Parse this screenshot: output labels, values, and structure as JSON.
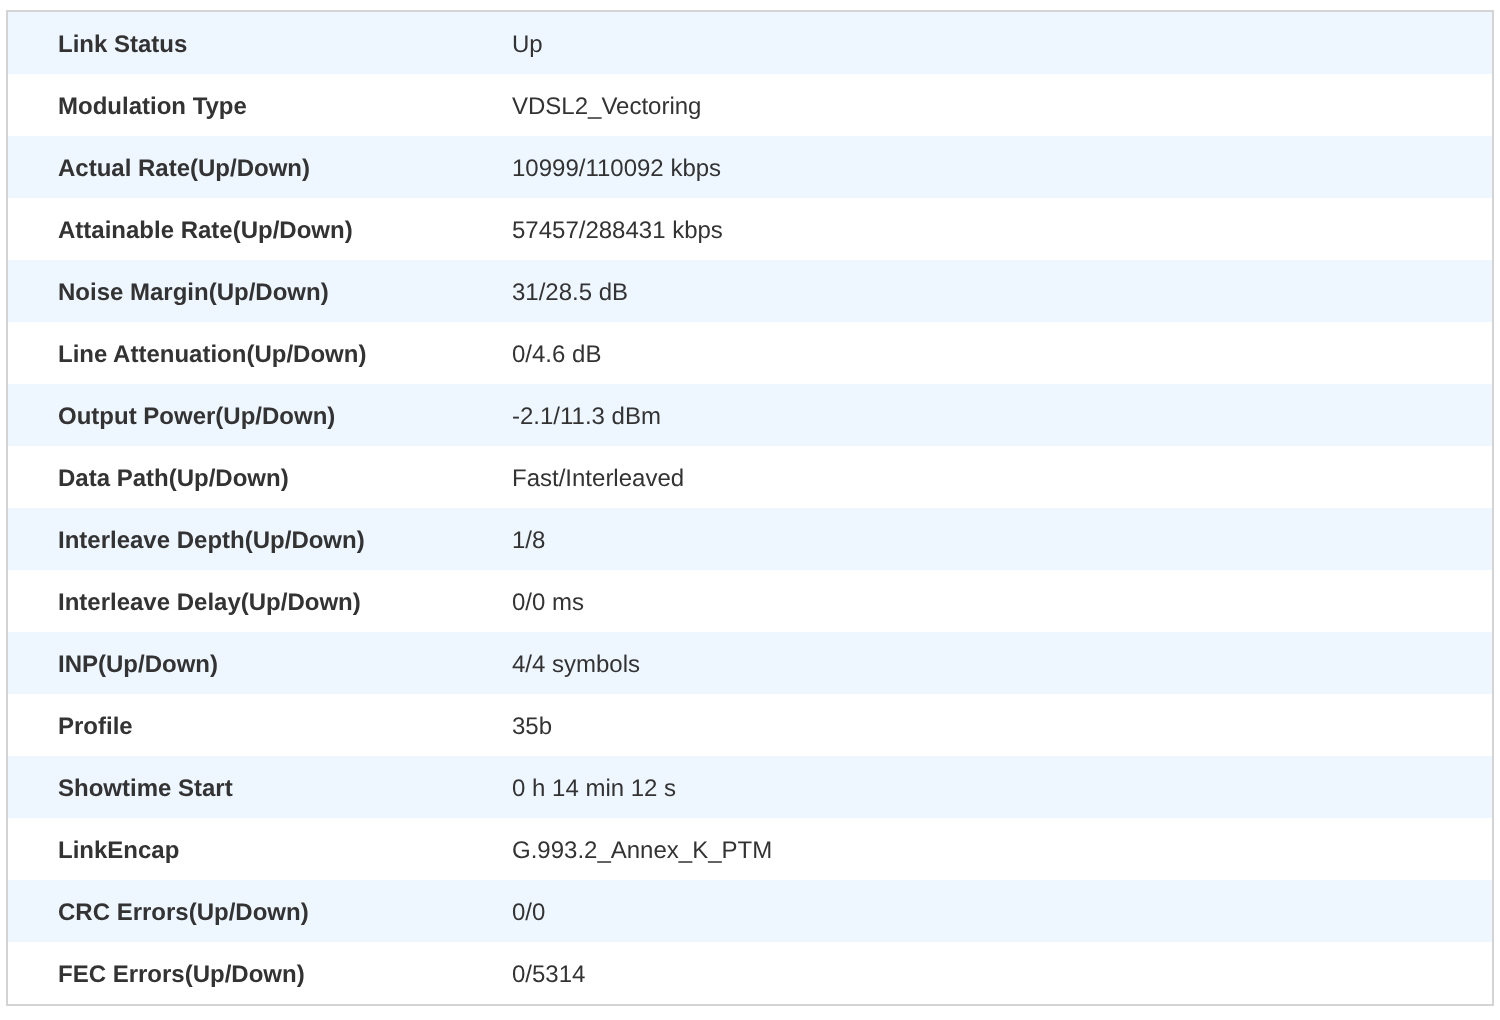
{
  "rows": [
    {
      "label": "Link Status",
      "value": "Up"
    },
    {
      "label": "Modulation Type",
      "value": "VDSL2_Vectoring"
    },
    {
      "label": "Actual Rate(Up/Down)",
      "value": "10999/110092 kbps"
    },
    {
      "label": "Attainable Rate(Up/Down)",
      "value": "57457/288431 kbps"
    },
    {
      "label": "Noise Margin(Up/Down)",
      "value": "31/28.5 dB"
    },
    {
      "label": "Line Attenuation(Up/Down)",
      "value": "0/4.6 dB"
    },
    {
      "label": "Output Power(Up/Down)",
      "value": "-2.1/11.3 dBm"
    },
    {
      "label": "Data Path(Up/Down)",
      "value": "Fast/Interleaved"
    },
    {
      "label": "Interleave Depth(Up/Down)",
      "value": "1/8"
    },
    {
      "label": "Interleave Delay(Up/Down)",
      "value": "0/0 ms"
    },
    {
      "label": "INP(Up/Down)",
      "value": "4/4 symbols"
    },
    {
      "label": "Profile",
      "value": "35b"
    },
    {
      "label": "Showtime Start",
      "value": "0 h 14 min 12 s"
    },
    {
      "label": "LinkEncap",
      "value": "G.993.2_Annex_K_PTM"
    },
    {
      "label": "CRC Errors(Up/Down)",
      "value": "0/0"
    },
    {
      "label": "FEC Errors(Up/Down)",
      "value": "0/5314"
    }
  ]
}
